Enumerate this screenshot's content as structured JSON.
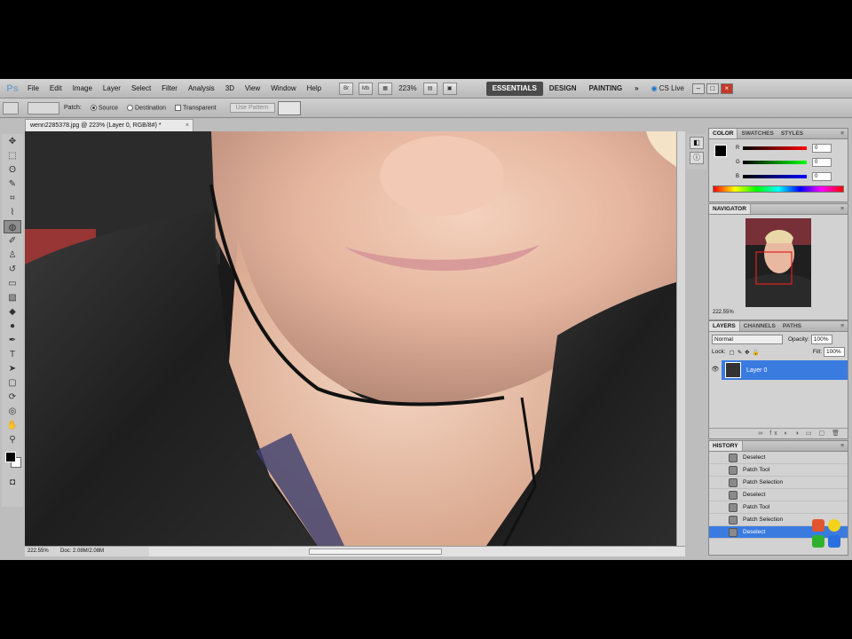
{
  "app": {
    "logo": "Ps",
    "menu": [
      "File",
      "Edit",
      "Image",
      "Layer",
      "Select",
      "Filter",
      "Analysis",
      "3D",
      "View",
      "Window",
      "Help"
    ],
    "bridge_label": "Br",
    "minibridge_label": "Mb",
    "zoom_value": "223%",
    "workspaces": [
      "ESSENTIALS",
      "DESIGN",
      "PAINTING"
    ],
    "more_workspaces": "»",
    "cs_live": "CS Live"
  },
  "options": {
    "patch_label": "Patch:",
    "source_label": "Source",
    "destination_label": "Destination",
    "transparent_label": "Transparent",
    "use_pattern_label": "Use Pattern"
  },
  "document": {
    "tab_title": "wenn2285378.jpg @ 223% (Layer 0, RGB/8#) *",
    "close": "×",
    "status_zoom": "222.55%",
    "status_doc": "Doc: 2.08M/2.08M"
  },
  "color_panel": {
    "tabs": [
      "COLOR",
      "SWATCHES",
      "STYLES"
    ],
    "r_label": "R",
    "g_label": "G",
    "b_label": "B",
    "r_value": "0",
    "g_value": "0",
    "b_value": "0"
  },
  "navigator": {
    "title": "NAVIGATOR",
    "zoom": "222.55%"
  },
  "layers_panel": {
    "tabs": [
      "LAYERS",
      "CHANNELS",
      "PATHS"
    ],
    "blend_mode": "Normal",
    "opacity_label": "Opacity:",
    "opacity_value": "100%",
    "lock_label": "Lock:",
    "fill_label": "Fill:",
    "fill_value": "100%",
    "layer_name": "Layer 0"
  },
  "history": {
    "title": "HISTORY",
    "items": [
      "Deselect",
      "Patch Tool",
      "Patch Selection",
      "Deselect",
      "Patch Tool",
      "Patch Selection",
      "Deselect"
    ]
  }
}
